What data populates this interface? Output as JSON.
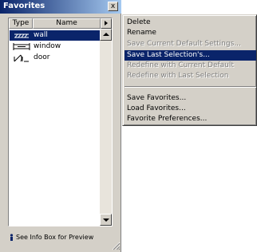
{
  "window": {
    "title": "Favorites",
    "close_glyph": "x"
  },
  "list": {
    "columns": [
      "Type",
      "Name"
    ],
    "items": [
      {
        "label": "wall",
        "icon": "wall-icon",
        "selected": true
      },
      {
        "label": "window",
        "icon": "window-icon",
        "selected": false
      },
      {
        "label": "door",
        "icon": "door-icon",
        "selected": false
      }
    ]
  },
  "preview_link": {
    "label": "See Info Box for Preview",
    "icon": "info-icon"
  },
  "menu": {
    "items": [
      {
        "label": "Delete",
        "state": "enabled"
      },
      {
        "label": "Rename",
        "state": "enabled"
      },
      {
        "label": "Save Current Default Settings...",
        "state": "disabled"
      },
      {
        "label": "Save Last Selection's...",
        "state": "highlighted"
      },
      {
        "label": "Redefine with Current Default",
        "state": "disabled"
      },
      {
        "label": "Redefine with Last Selection",
        "state": "disabled"
      },
      {
        "label": "Save Favorites...",
        "state": "enabled"
      },
      {
        "label": "Load Favorites...",
        "state": "enabled"
      },
      {
        "label": "Favorite Preferences...",
        "state": "enabled"
      }
    ]
  },
  "colors": {
    "titlebar": "#0a246a",
    "selection": "#0a246a",
    "face": "#d4d0c8",
    "disabled_text": "#808080"
  }
}
